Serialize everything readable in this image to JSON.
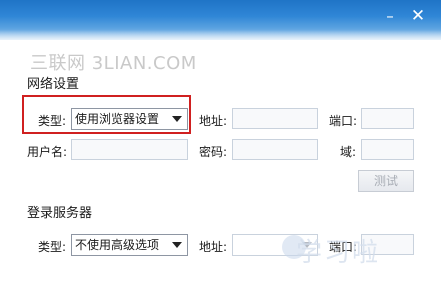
{
  "window": {
    "minimize_icon": "minimize-icon",
    "close_icon": "close-icon",
    "accent_color": "#2f86d6"
  },
  "watermark_top": "三联网 3LIAN.COM",
  "network": {
    "section_title": "网络设置",
    "type_label": "类型:",
    "type_value": "使用浏览器设置",
    "address_label": "地址:",
    "address_value": "",
    "port_label": "端口:",
    "port_value": "",
    "username_label": "用户名:",
    "username_value": "",
    "password_label": "密码:",
    "password_value": "",
    "domain_label": "域:",
    "domain_value": "",
    "test_button": "测试"
  },
  "login_server": {
    "section_title": "登录服务器",
    "type_label": "类型:",
    "type_value": "不使用高级选项",
    "address_label": "地址:",
    "address_value": "",
    "port_label": "端口:",
    "port_value": ""
  },
  "watermark_bottom": "学习啦",
  "highlight_color": "#d02020"
}
